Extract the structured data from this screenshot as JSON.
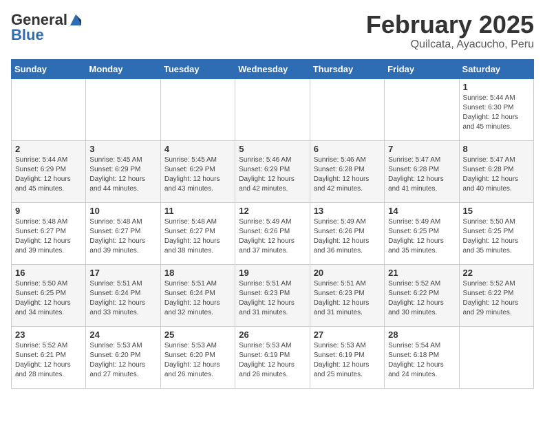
{
  "header": {
    "logo_general": "General",
    "logo_blue": "Blue",
    "month_year": "February 2025",
    "location": "Quilcata, Ayacucho, Peru"
  },
  "days_of_week": [
    "Sunday",
    "Monday",
    "Tuesday",
    "Wednesday",
    "Thursday",
    "Friday",
    "Saturday"
  ],
  "weeks": [
    {
      "cells": [
        {
          "day": "",
          "info": ""
        },
        {
          "day": "",
          "info": ""
        },
        {
          "day": "",
          "info": ""
        },
        {
          "day": "",
          "info": ""
        },
        {
          "day": "",
          "info": ""
        },
        {
          "day": "",
          "info": ""
        },
        {
          "day": "1",
          "info": "Sunrise: 5:44 AM\nSunset: 6:30 PM\nDaylight: 12 hours\nand 45 minutes."
        }
      ]
    },
    {
      "cells": [
        {
          "day": "2",
          "info": "Sunrise: 5:44 AM\nSunset: 6:29 PM\nDaylight: 12 hours\nand 45 minutes."
        },
        {
          "day": "3",
          "info": "Sunrise: 5:45 AM\nSunset: 6:29 PM\nDaylight: 12 hours\nand 44 minutes."
        },
        {
          "day": "4",
          "info": "Sunrise: 5:45 AM\nSunset: 6:29 PM\nDaylight: 12 hours\nand 43 minutes."
        },
        {
          "day": "5",
          "info": "Sunrise: 5:46 AM\nSunset: 6:29 PM\nDaylight: 12 hours\nand 42 minutes."
        },
        {
          "day": "6",
          "info": "Sunrise: 5:46 AM\nSunset: 6:28 PM\nDaylight: 12 hours\nand 42 minutes."
        },
        {
          "day": "7",
          "info": "Sunrise: 5:47 AM\nSunset: 6:28 PM\nDaylight: 12 hours\nand 41 minutes."
        },
        {
          "day": "8",
          "info": "Sunrise: 5:47 AM\nSunset: 6:28 PM\nDaylight: 12 hours\nand 40 minutes."
        }
      ]
    },
    {
      "cells": [
        {
          "day": "9",
          "info": "Sunrise: 5:48 AM\nSunset: 6:27 PM\nDaylight: 12 hours\nand 39 minutes."
        },
        {
          "day": "10",
          "info": "Sunrise: 5:48 AM\nSunset: 6:27 PM\nDaylight: 12 hours\nand 39 minutes."
        },
        {
          "day": "11",
          "info": "Sunrise: 5:48 AM\nSunset: 6:27 PM\nDaylight: 12 hours\nand 38 minutes."
        },
        {
          "day": "12",
          "info": "Sunrise: 5:49 AM\nSunset: 6:26 PM\nDaylight: 12 hours\nand 37 minutes."
        },
        {
          "day": "13",
          "info": "Sunrise: 5:49 AM\nSunset: 6:26 PM\nDaylight: 12 hours\nand 36 minutes."
        },
        {
          "day": "14",
          "info": "Sunrise: 5:49 AM\nSunset: 6:25 PM\nDaylight: 12 hours\nand 35 minutes."
        },
        {
          "day": "15",
          "info": "Sunrise: 5:50 AM\nSunset: 6:25 PM\nDaylight: 12 hours\nand 35 minutes."
        }
      ]
    },
    {
      "cells": [
        {
          "day": "16",
          "info": "Sunrise: 5:50 AM\nSunset: 6:25 PM\nDaylight: 12 hours\nand 34 minutes."
        },
        {
          "day": "17",
          "info": "Sunrise: 5:51 AM\nSunset: 6:24 PM\nDaylight: 12 hours\nand 33 minutes."
        },
        {
          "day": "18",
          "info": "Sunrise: 5:51 AM\nSunset: 6:24 PM\nDaylight: 12 hours\nand 32 minutes."
        },
        {
          "day": "19",
          "info": "Sunrise: 5:51 AM\nSunset: 6:23 PM\nDaylight: 12 hours\nand 31 minutes."
        },
        {
          "day": "20",
          "info": "Sunrise: 5:51 AM\nSunset: 6:23 PM\nDaylight: 12 hours\nand 31 minutes."
        },
        {
          "day": "21",
          "info": "Sunrise: 5:52 AM\nSunset: 6:22 PM\nDaylight: 12 hours\nand 30 minutes."
        },
        {
          "day": "22",
          "info": "Sunrise: 5:52 AM\nSunset: 6:22 PM\nDaylight: 12 hours\nand 29 minutes."
        }
      ]
    },
    {
      "cells": [
        {
          "day": "23",
          "info": "Sunrise: 5:52 AM\nSunset: 6:21 PM\nDaylight: 12 hours\nand 28 minutes."
        },
        {
          "day": "24",
          "info": "Sunrise: 5:53 AM\nSunset: 6:20 PM\nDaylight: 12 hours\nand 27 minutes."
        },
        {
          "day": "25",
          "info": "Sunrise: 5:53 AM\nSunset: 6:20 PM\nDaylight: 12 hours\nand 26 minutes."
        },
        {
          "day": "26",
          "info": "Sunrise: 5:53 AM\nSunset: 6:19 PM\nDaylight: 12 hours\nand 26 minutes."
        },
        {
          "day": "27",
          "info": "Sunrise: 5:53 AM\nSunset: 6:19 PM\nDaylight: 12 hours\nand 25 minutes."
        },
        {
          "day": "28",
          "info": "Sunrise: 5:54 AM\nSunset: 6:18 PM\nDaylight: 12 hours\nand 24 minutes."
        },
        {
          "day": "",
          "info": ""
        }
      ]
    }
  ]
}
